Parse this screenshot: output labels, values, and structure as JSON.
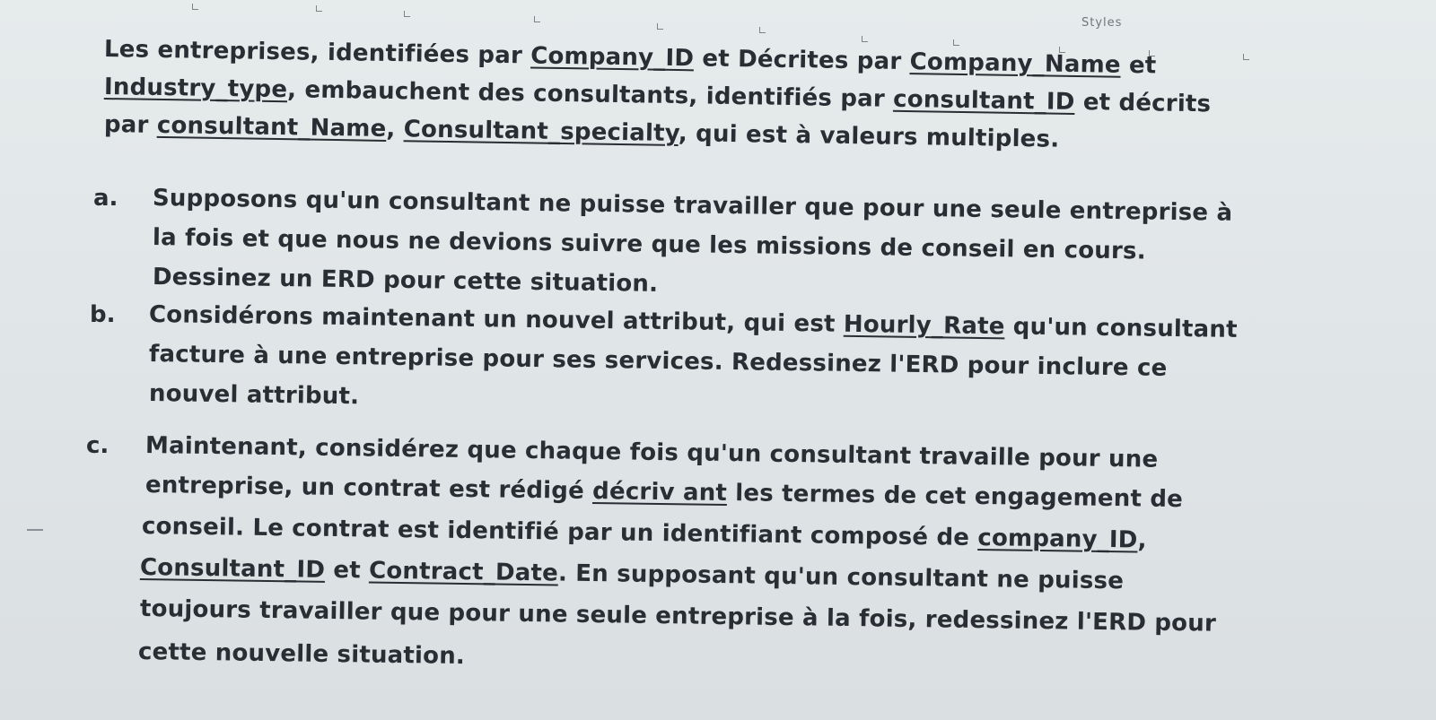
{
  "toolbar": {
    "styles_label": "Styles"
  },
  "intro": {
    "l1": {
      "a": "Les entreprises, identifiées par ",
      "u1": "Company_ID",
      "b": " et Décrites par ",
      "u2": "Company_Name",
      "c": " et"
    },
    "l2": {
      "u1": "Industry_type",
      "a": ", embauchent des consultants, identifiés par ",
      "u2": "consultant_ID",
      "b": " et décrits"
    },
    "l3": {
      "a": "par ",
      "u1": "consultant_Name",
      "b": ", ",
      "u2": "Consultant_specialty",
      "c": ", qui est à valeurs multiples."
    }
  },
  "item_a": {
    "label": "a.",
    "l1": "Supposons qu'un consultant ne puisse travailler que pour une seule entreprise à",
    "l2": "la fois et que nous ne devions suivre que les missions de conseil en cours.",
    "l3": "Dessinez un ERD pour cette situation."
  },
  "item_b": {
    "label": "b.",
    "l1": {
      "a": "Considérons maintenant un nouvel attribut, qui est ",
      "u1": "Hourly_Rate",
      "b": " qu'un consultant"
    },
    "l2": "facture à une entreprise pour ses services. Redessinez l'ERD pour inclure ce",
    "l3": "nouvel attribut."
  },
  "item_c": {
    "label": "c.",
    "l1": "Maintenant, considérez que chaque fois qu'un consultant travaille pour une",
    "l2": {
      "a": "entreprise, un contrat est rédigé ",
      "u1": "décriv ant",
      "b": " les termes de cet engagement de"
    },
    "l3": {
      "a": "conseil. Le contrat est identifié par un identifiant composé de ",
      "u1": "company_ID",
      "b": ","
    },
    "l4": {
      "u1": "Consultant_ID",
      "a": " et ",
      "u2": "Contract_Date",
      "b": ". En supposant qu'un consultant ne puisse"
    },
    "l5": "toujours travailler que pour une seule entreprise à la fois, redessinez l'ERD pour",
    "l6": "cette nouvelle situation."
  }
}
